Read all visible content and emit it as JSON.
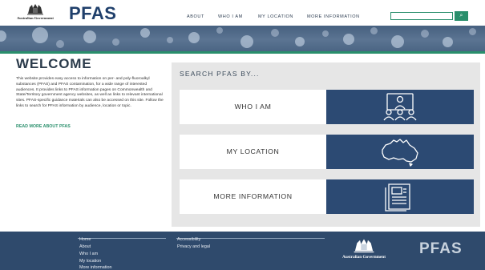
{
  "header": {
    "gov_label": "Australian Government",
    "logo": "PFAS",
    "nav": [
      {
        "label": "ABOUT"
      },
      {
        "label": "WHO I AM"
      },
      {
        "label": "MY LOCATION"
      },
      {
        "label": "MORE INFORMATION"
      }
    ],
    "search": {
      "value": "",
      "placeholder": "",
      "button_icon": "search-icon",
      "button_glyph": "⌕"
    }
  },
  "welcome": {
    "title": "WELCOME",
    "body": "This website provides easy access to information on per- and poly-fluoroalkyl substances (PFAS) and PFAS contamination, for a wide range of interested audiences. It provides links to PFAS information pages on Commonwealth and State/Territory government agency websites, as well as links to relevant international sites. PFAS-specific guidance materials can also be accessed on this site. Follow the links to search for PFAS information by audience, location or topic.",
    "read_more": "READ MORE ABOUT PFAS"
  },
  "search_panel": {
    "title": "SEARCH PFAS BY...",
    "cards": [
      {
        "label": "WHO I AM",
        "icon": "audience-icon"
      },
      {
        "label": "MY LOCATION",
        "icon": "australia-map-icon"
      },
      {
        "label": "MORE INFORMATION",
        "icon": "document-icon"
      }
    ]
  },
  "footer": {
    "col1": [
      "Home",
      "About",
      "Who I am",
      "My location",
      "More information"
    ],
    "col2": [
      "Accessibility",
      "Privacy and legal"
    ],
    "gov_label": "Australian Government",
    "logo": "PFAS"
  },
  "colors": {
    "brand_navy": "#1f3f6b",
    "accent_green": "#2a8f6c",
    "card_blue": "#2c4a73",
    "footer_bg": "#2f4a6c",
    "panel_bg": "#e6e6e6"
  }
}
